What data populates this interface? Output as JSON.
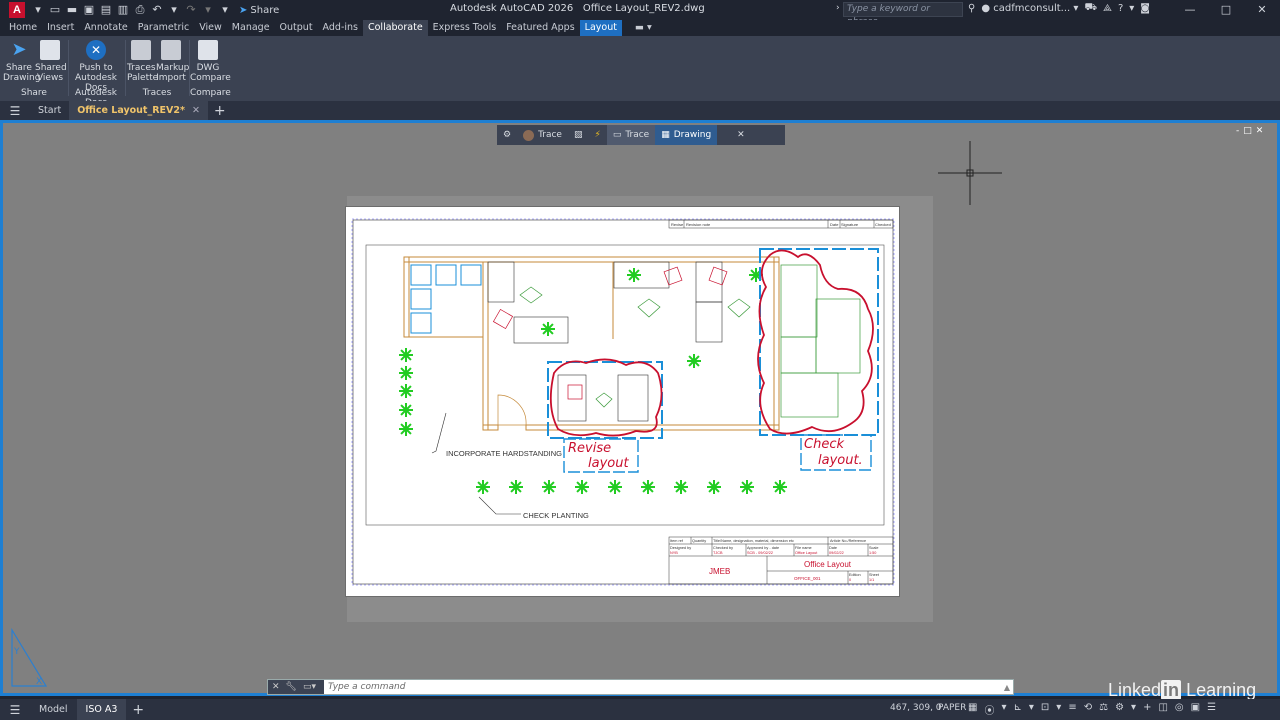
{
  "titlebar": {
    "logo_letter": "A",
    "share_label": "Share",
    "app_title": "Autodesk AutoCAD 2026",
    "file_title": "Office Layout_REV2.dwg",
    "search_placeholder": "Type a keyword or phrase",
    "user": "cadfmconsult...",
    "window_controls": [
      "—",
      "□",
      "✕"
    ]
  },
  "ribbon_tabs": [
    "Home",
    "Insert",
    "Annotate",
    "Parametric",
    "View",
    "Manage",
    "Output",
    "Add-ins",
    "Collaborate",
    "Express Tools",
    "Featured Apps",
    "Layout"
  ],
  "ribbon": {
    "share_group": {
      "label": "Share",
      "buttons": [
        {
          "line1": "Share",
          "line2": "Drawing"
        },
        {
          "line1": "Shared",
          "line2": "Views"
        }
      ]
    },
    "docs_group": {
      "label": "Autodesk Docs",
      "buttons": [
        {
          "line1": "Push to",
          "line2": "Autodesk Docs"
        }
      ]
    },
    "traces_group": {
      "label": "Traces",
      "buttons": [
        {
          "line1": "Traces",
          "line2": "Palette"
        },
        {
          "line1": "Markup",
          "line2": "Import"
        }
      ]
    },
    "compare_group": {
      "label": "Compare",
      "buttons": [
        {
          "line1": "DWG",
          "line2": "Compare"
        }
      ]
    }
  },
  "doc_tabs": {
    "start": "Start",
    "active": "Office Layout_REV2*"
  },
  "trace_toolbar": {
    "trace1": "Trace",
    "trace2": "Trace",
    "drawing": "Drawing"
  },
  "drawing": {
    "title_block": {
      "revision_headers": [
        "Revise",
        "Revision note",
        "Date",
        "Signature",
        "Checked"
      ],
      "row1": [
        "Item ref",
        "Quantity",
        "Title/Name, designation, material, dimension etc",
        "Article No./Reference"
      ],
      "designed_by": "Designed by",
      "designed_val": "NYB",
      "checked_by": "Checked by",
      "checked_val": "TJCB",
      "approved_by": "Approved by - date",
      "approved_val": "SCB - 09/02/22",
      "file_name": "File name",
      "file_val": "Office Layout",
      "date": "Date",
      "date_val": "09/02/22",
      "scale": "Scale",
      "scale_val": "1:50",
      "company": "JMEB",
      "drawing_title": "Office Layout",
      "drawing_no": "OFFICE_001",
      "edition": "Edition",
      "edition_val": "0",
      "sheet": "Sheet",
      "sheet_val": "1/1"
    },
    "annotations": {
      "hardstanding": "INCORPORATE HARDSTANDING",
      "planting": "CHECK PLANTING",
      "markup1_line1": "Revise",
      "markup1_line2": "layout",
      "markup2_line1": "Check",
      "markup2_line2": "layout."
    },
    "colors": {
      "wall": "#c58a3a",
      "furniture": "#3a9a3a",
      "window": "#1a8fd8",
      "markup": "#c8102e",
      "plant": "#22cc22"
    }
  },
  "command_line": {
    "placeholder": "Type a command"
  },
  "statusbar": {
    "model_tab": "Model",
    "layout_tab": "ISO A3",
    "coords": "467, 309, 0",
    "space": "PAPER"
  },
  "watermark": {
    "brand1": "Linked",
    "brand_in": "in",
    "brand2": "Learning"
  }
}
